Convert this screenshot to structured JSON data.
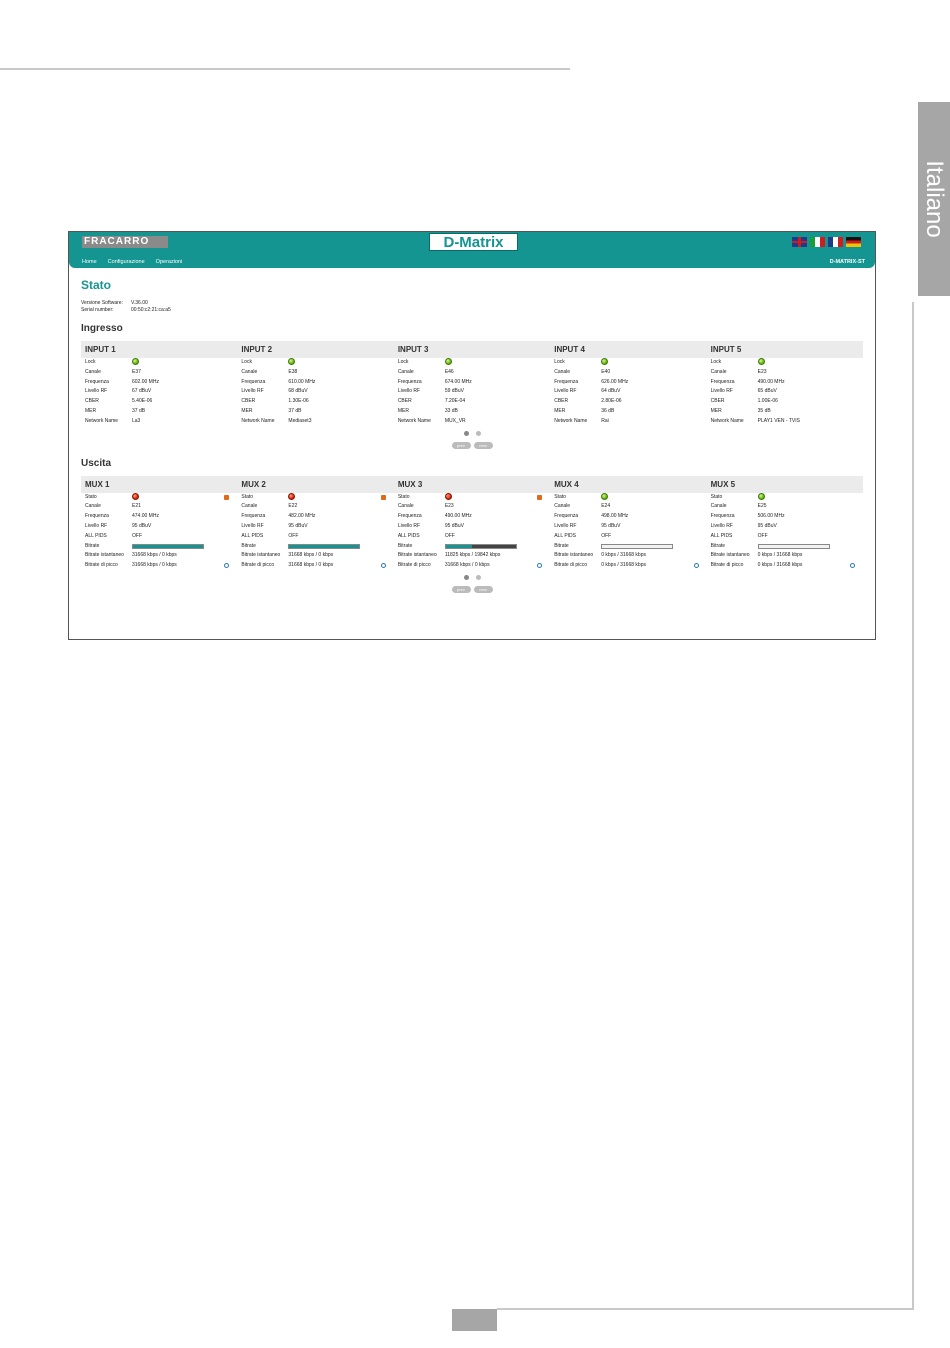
{
  "page": {
    "side_tab": "Italiano"
  },
  "header": {
    "logo": "FRACARRO",
    "brand": "D-Matrix",
    "nav": [
      "Home",
      "Configurazione",
      "Operazioni"
    ],
    "model": "D-MATRIX-ST",
    "flags": [
      "flag-en-icon",
      "flag-it-icon",
      "flag-fr-icon",
      "flag-de-icon"
    ]
  },
  "stato": {
    "title": "Stato",
    "software_label": "Versione Software:",
    "software_value": "V.36.00",
    "serial_label": "Serial number:",
    "serial_value": "00:50:c2:21:ca:a5"
  },
  "ingresso": {
    "title": "Ingresso",
    "labels": [
      "Lock",
      "Canale",
      "Frequenza",
      "Livello RF",
      "CBER",
      "MER",
      "Network Name"
    ],
    "inputs": [
      {
        "name": "INPUT 1",
        "lock": "green",
        "canale": "E37",
        "frequenza": "602.00 MHz",
        "livello": "67 dBuV",
        "cber": "5.40E-06",
        "mer": "37 dB",
        "network": "La3"
      },
      {
        "name": "INPUT 2",
        "lock": "green",
        "canale": "E38",
        "frequenza": "610.00 MHz",
        "livello": "68 dBuV",
        "cber": "1.30E-06",
        "mer": "37 dB",
        "network": "Mediaset3"
      },
      {
        "name": "INPUT 3",
        "lock": "green",
        "canale": "E46",
        "frequenza": "674.00 MHz",
        "livello": "59 dBuV",
        "cber": "7.20E-04",
        "mer": "33 dB",
        "network": "MUX_VR"
      },
      {
        "name": "INPUT 4",
        "lock": "green",
        "canale": "E40",
        "frequenza": "626.00 MHz",
        "livello": "64 dBuV",
        "cber": "2.80E-06",
        "mer": "36 dB",
        "network": "Rai"
      },
      {
        "name": "INPUT 5",
        "lock": "green",
        "canale": "E23",
        "frequenza": "490.00 MHz",
        "livello": "65 dBuV",
        "cber": "1.00E-06",
        "mer": "35 dB",
        "network": "PLAY1 VEN - TVIS"
      }
    ],
    "pager": {
      "prev": "prev",
      "next": "next"
    }
  },
  "uscita": {
    "title": "Uscita",
    "labels": [
      "Stato",
      "Canale",
      "Frequenza",
      "Livello RF",
      "ALL PIDS",
      "Bitrate",
      "Bitrate istantaneo",
      "Bitrate di picco"
    ],
    "muxes": [
      {
        "name": "MUX 1",
        "stato": "red",
        "canale": "E21",
        "frequenza": "474.00 MHz",
        "livello": "95 dBuV",
        "allpids": "OFF",
        "bitrate_fill": 1.0,
        "bitrate_dark": false,
        "istantaneo": "31668 kbps / 0 kbps",
        "picco": "31668 kbps / 0 kbps"
      },
      {
        "name": "MUX 2",
        "stato": "red",
        "canale": "E22",
        "frequenza": "482.00 MHz",
        "livello": "95 dBuV",
        "allpids": "OFF",
        "bitrate_fill": 1.0,
        "bitrate_dark": false,
        "istantaneo": "31668 kbps / 0 kbps",
        "picco": "31668 kbps / 0 kbps"
      },
      {
        "name": "MUX 3",
        "stato": "red",
        "canale": "E23",
        "frequenza": "490.00 MHz",
        "livello": "95 dBuV",
        "allpids": "OFF",
        "bitrate_fill": 0.37,
        "bitrate_dark": true,
        "istantaneo": "11825 kbps / 19842 kbps",
        "picco": "31668 kbps / 0 kbps"
      },
      {
        "name": "MUX 4",
        "stato": "green",
        "canale": "E24",
        "frequenza": "498.00 MHz",
        "livello": "95 dBuV",
        "allpids": "OFF",
        "bitrate_fill": 0.0,
        "bitrate_dark": false,
        "istantaneo": "0 kbps / 31668 kbps",
        "picco": "0 kbps / 31668 kbps"
      },
      {
        "name": "MUX 5",
        "stato": "green",
        "canale": "E25",
        "frequenza": "506.00 MHz",
        "livello": "95 dBuV",
        "allpids": "OFF",
        "bitrate_fill": 0.0,
        "bitrate_dark": false,
        "istantaneo": "0 kbps / 31668 kbps",
        "picco": "0 kbps / 31668 kbps"
      }
    ],
    "pager": {
      "prev": "prev",
      "next": "next"
    }
  }
}
